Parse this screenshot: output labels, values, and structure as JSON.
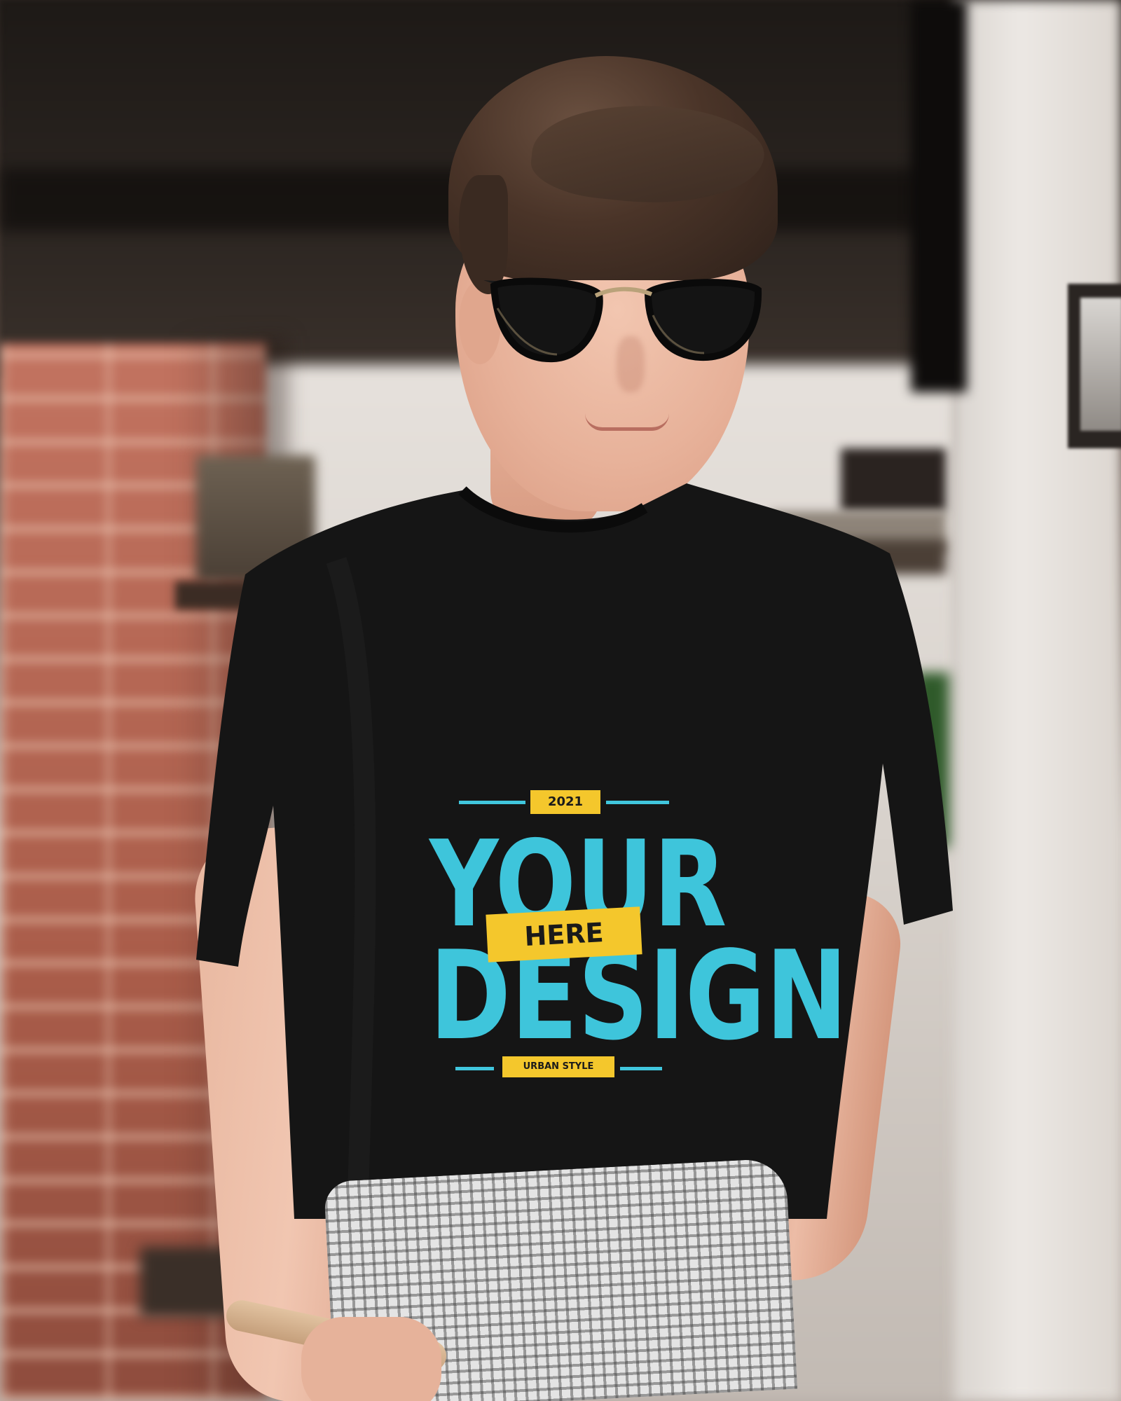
{
  "tshirt_design": {
    "year": "2021",
    "line1": "YOUR",
    "tag": "HERE",
    "line2": "DESIGN",
    "tagline": "URBAN STYLE"
  },
  "colors": {
    "shirt": "#151515",
    "print_cyan": "#3ec5db",
    "print_yellow": "#f4c72c",
    "brick": "#b56a55",
    "wall": "#e6e1dc"
  }
}
